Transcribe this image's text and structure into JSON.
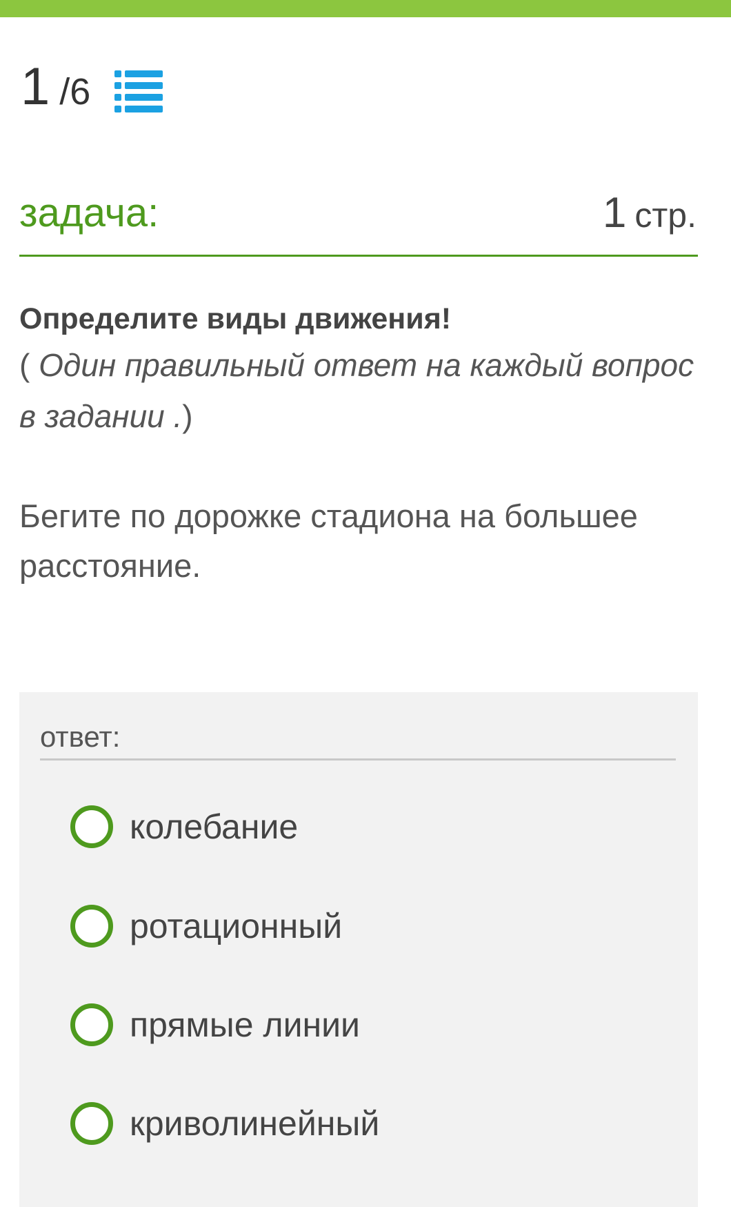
{
  "colors": {
    "accent": "#8cc63f",
    "green": "#4e9a1e",
    "icon_blue": "#1ba1e2",
    "panel_bg": "#f2f2f2"
  },
  "progress": {
    "current": "1",
    "separator": "/",
    "total": "6",
    "icon": "list-icon"
  },
  "task": {
    "label": "задача:",
    "points": "1",
    "points_unit": "стр."
  },
  "instruction": {
    "title": "Определите виды движения!",
    "hint_open": "( ",
    "hint_text": "Один правильный ответ на каждый вопрос в задании .",
    "hint_close": ")"
  },
  "question": "Бегите по дорожке стадиона на большее расстояние.",
  "answer": {
    "label": "ответ:",
    "options": [
      {
        "label": "колебание",
        "selected": false
      },
      {
        "label": "ротационный",
        "selected": false
      },
      {
        "label": "прямые линии",
        "selected": false
      },
      {
        "label": "криволинейный",
        "selected": false
      }
    ]
  }
}
